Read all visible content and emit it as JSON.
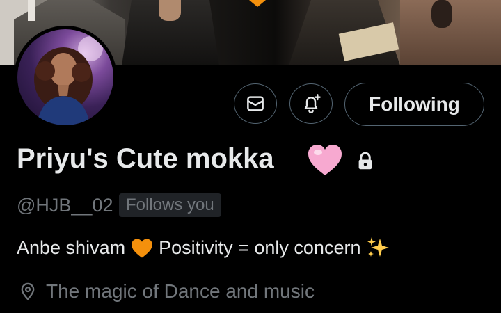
{
  "profile": {
    "display_name": "Priyu's Cute mokka",
    "handle": "@HJB__02",
    "follows_you": "Follows you",
    "bio_part1": "Anbe shivam",
    "bio_part2": "Positivity = only concern",
    "location": "The magic of Dance and music"
  },
  "actions": {
    "following_label": "Following"
  },
  "icons": {
    "message": "mail-icon",
    "notify": "bell-plus-icon",
    "verified_lock": "lock-icon",
    "location": "location-pin-icon",
    "heart": "pink-heart-emoji",
    "orange_heart": "orange-heart-emoji",
    "sparkles": "sparkles-emoji"
  },
  "colors": {
    "background": "#000000",
    "text_primary": "#e7e9ea",
    "text_secondary": "#71767b",
    "border": "#536471",
    "badge_bg": "#202327",
    "accent_orange": "#f4900c",
    "pink_heart": "#f7a9d0"
  }
}
